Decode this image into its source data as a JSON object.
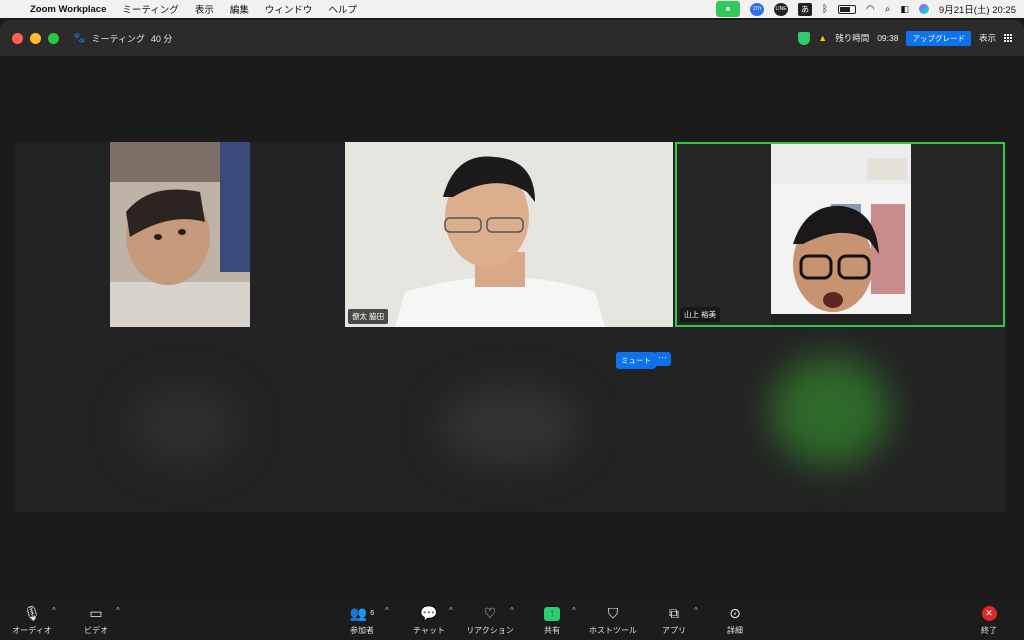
{
  "menubar": {
    "app": "Zoom Workplace",
    "items": [
      "ミーティング",
      "表示",
      "編集",
      "ウィンドウ",
      "ヘルプ"
    ],
    "ime": "あ",
    "datetime": "9月21日(土)  20:25"
  },
  "titlebar": {
    "meeting_label": "ミーティング",
    "duration": "40 分",
    "remaining_label": "残り時間",
    "remaining_time": "09:38",
    "upgrade": "アップグレード",
    "view": "表示"
  },
  "participants": [
    {
      "name": ""
    },
    {
      "name": "僚太 脇田"
    },
    {
      "name": "山上 裕美"
    }
  ],
  "mute_button": "ミュート",
  "more_button": "···",
  "toolbar": {
    "audio": "オーディオ",
    "video": "ビデオ",
    "participants": "参加者",
    "participants_count": "6",
    "chat": "チャット",
    "reactions": "リアクション",
    "share": "共有",
    "host_tools": "ホストツール",
    "apps": "アプリ",
    "more": "詳細",
    "end": "終了"
  },
  "colors": {
    "accent_blue": "#0e72ed",
    "active_speaker": "#2ecc40",
    "share_green": "#2ecc71",
    "end_red": "#e02828"
  }
}
